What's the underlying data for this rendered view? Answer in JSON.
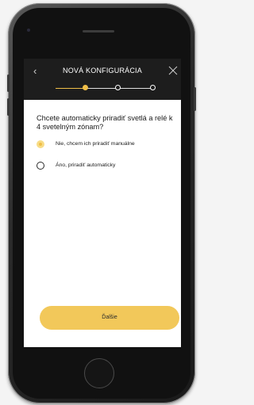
{
  "header": {
    "title": "NOVÁ KONFIGURÁCIA",
    "back_icon": "chevron-left-icon",
    "close_icon": "close-icon"
  },
  "stepper": {
    "total_steps": 3,
    "current_step": 1
  },
  "question": "Chcete automaticky priradiť svetlá a relé k 4 svetelným zónam?",
  "options": [
    {
      "label": "Nie, chcem ich priradiť manuálne",
      "selected": true
    },
    {
      "label": "Áno, priradiť automaticky",
      "selected": false
    }
  ],
  "next_button": {
    "label": "Ďalšie"
  },
  "colors": {
    "accent": "#f0be48",
    "header_bg": "#1d1d1d",
    "button_bg": "#f2c85a"
  }
}
